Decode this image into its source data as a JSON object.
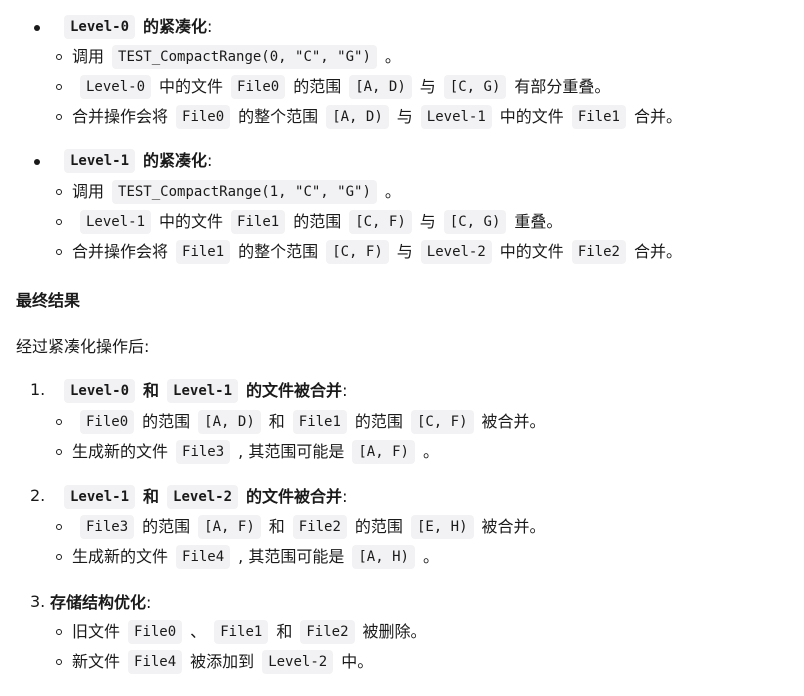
{
  "section_a": {
    "code": "Level-0",
    "title": "的紧凑化",
    "colon": ":",
    "items": [
      {
        "t1": "调用",
        "c1": "TEST_CompactRange(0, \"C\", \"G\")",
        "t2": "。"
      },
      {
        "c1": "Level-0",
        "t1": "中的文件",
        "c2": "File0",
        "t2": "的范围",
        "c3": "[A, D)",
        "t3": "与",
        "c4": "[C, G)",
        "t4": "有部分重叠。"
      },
      {
        "t1": "合并操作会将",
        "c1": "File0",
        "t2": "的整个范围",
        "c2": "[A, D)",
        "t3": "与",
        "c3": "Level-1",
        "t4": "中的文件",
        "c4": "File1",
        "t5": "合并。"
      }
    ]
  },
  "section_b": {
    "code": "Level-1",
    "title": "的紧凑化",
    "colon": ":",
    "items": [
      {
        "t1": "调用",
        "c1": "TEST_CompactRange(1, \"C\", \"G\")",
        "t2": "。"
      },
      {
        "c1": "Level-1",
        "t1": "中的文件",
        "c2": "File1",
        "t2": "的范围",
        "c3": "[C, F)",
        "t3": "与",
        "c4": "[C, G)",
        "t4": "重叠。"
      },
      {
        "t1": "合并操作会将",
        "c1": "File1",
        "t2": "的整个范围",
        "c2": "[C, F)",
        "t3": "与",
        "c3": "Level-2",
        "t4": "中的文件",
        "c4": "File2",
        "t5": "合并。"
      }
    ]
  },
  "final": {
    "heading": "最终结果",
    "intro": "经过紧凑化操作后:"
  },
  "step1": {
    "num": "1.",
    "c1": "Level-0",
    "t1": "和",
    "c2": "Level-1",
    "t2": "的文件被合并",
    "colon": ":",
    "items": [
      {
        "c1": "File0",
        "t1": "的范围",
        "c2": "[A, D)",
        "t2": "和",
        "c3": "File1",
        "t3": "的范围",
        "c4": "[C, F)",
        "t4": "被合并。"
      },
      {
        "t1": "生成新的文件",
        "c1": "File3",
        "t2": ", 其范围可能是",
        "c2": "[A, F)",
        "t3": "。"
      }
    ]
  },
  "step2": {
    "num": "2.",
    "c1": "Level-1",
    "t1": "和",
    "c2": "Level-2",
    "t2": "的文件被合并",
    "colon": ":",
    "items": [
      {
        "c1": "File3",
        "t1": "的范围",
        "c2": "[A, F)",
        "t2": "和",
        "c3": "File2",
        "t3": "的范围",
        "c4": "[E, H)",
        "t4": "被合并。"
      },
      {
        "t1": "生成新的文件",
        "c1": "File4",
        "t2": ", 其范围可能是",
        "c2": "[A, H)",
        "t3": "。"
      }
    ]
  },
  "step3": {
    "num": "3.",
    "title": "存储结构优化",
    "colon": ":",
    "items": [
      {
        "t1": "旧文件",
        "c1": "File0",
        "t2": "、",
        "c2": "File1",
        "t3": "和",
        "c3": "File2",
        "t4": "被删除。"
      },
      {
        "t1": "新文件",
        "c1": "File4",
        "t2": "被添加到",
        "c2": "Level-2",
        "t3": "中。"
      }
    ]
  }
}
